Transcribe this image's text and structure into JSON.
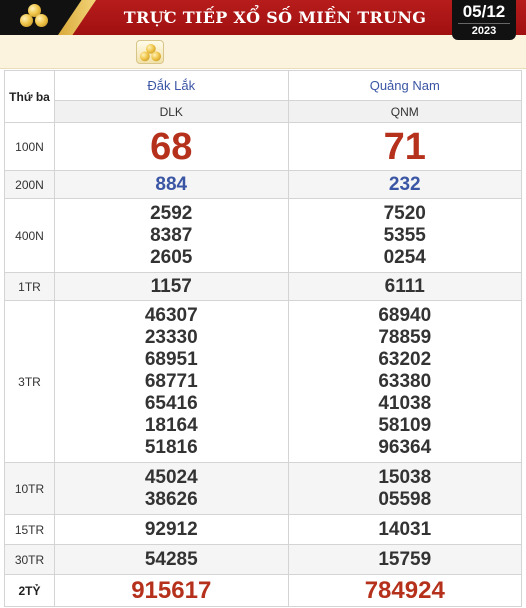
{
  "header": {
    "title": "TRỰC TIẾP XỔ SỐ MIỀN TRUNG",
    "date": "05/12",
    "year": "2023",
    "logo_icon": "gold-coins-icon"
  },
  "colors": {
    "header_red": "#b71c1c",
    "gold": "#f0c64a",
    "province_blue": "#3a55a4",
    "prize_red": "#b5311b"
  },
  "table": {
    "day_label": "Thứ ba",
    "provinces": [
      {
        "name": "Đắk Lắk",
        "code": "DLK"
      },
      {
        "name": "Quảng Nam",
        "code": "QNM"
      }
    ],
    "prizes": [
      {
        "label": "100N",
        "values": [
          [
            "68"
          ],
          [
            "71"
          ]
        ]
      },
      {
        "label": "200N",
        "values": [
          [
            "884"
          ],
          [
            "232"
          ]
        ]
      },
      {
        "label": "400N",
        "values": [
          [
            "2592",
            "8387",
            "2605"
          ],
          [
            "7520",
            "5355",
            "0254"
          ]
        ]
      },
      {
        "label": "1TR",
        "values": [
          [
            "1157"
          ],
          [
            "6111"
          ]
        ]
      },
      {
        "label": "3TR",
        "values": [
          [
            "46307",
            "23330",
            "68951",
            "68771",
            "65416",
            "18164",
            "51816"
          ],
          [
            "68940",
            "78859",
            "63202",
            "63380",
            "41038",
            "58109",
            "96364"
          ]
        ]
      },
      {
        "label": "10TR",
        "values": [
          [
            "45024",
            "38626"
          ],
          [
            "15038",
            "05598"
          ]
        ]
      },
      {
        "label": "15TR",
        "values": [
          [
            "92912"
          ],
          [
            "14031"
          ]
        ]
      },
      {
        "label": "30TR",
        "values": [
          [
            "54285"
          ],
          [
            "15759"
          ]
        ]
      },
      {
        "label": "2TỶ",
        "values": [
          [
            "915617"
          ],
          [
            "784924"
          ]
        ]
      }
    ]
  }
}
